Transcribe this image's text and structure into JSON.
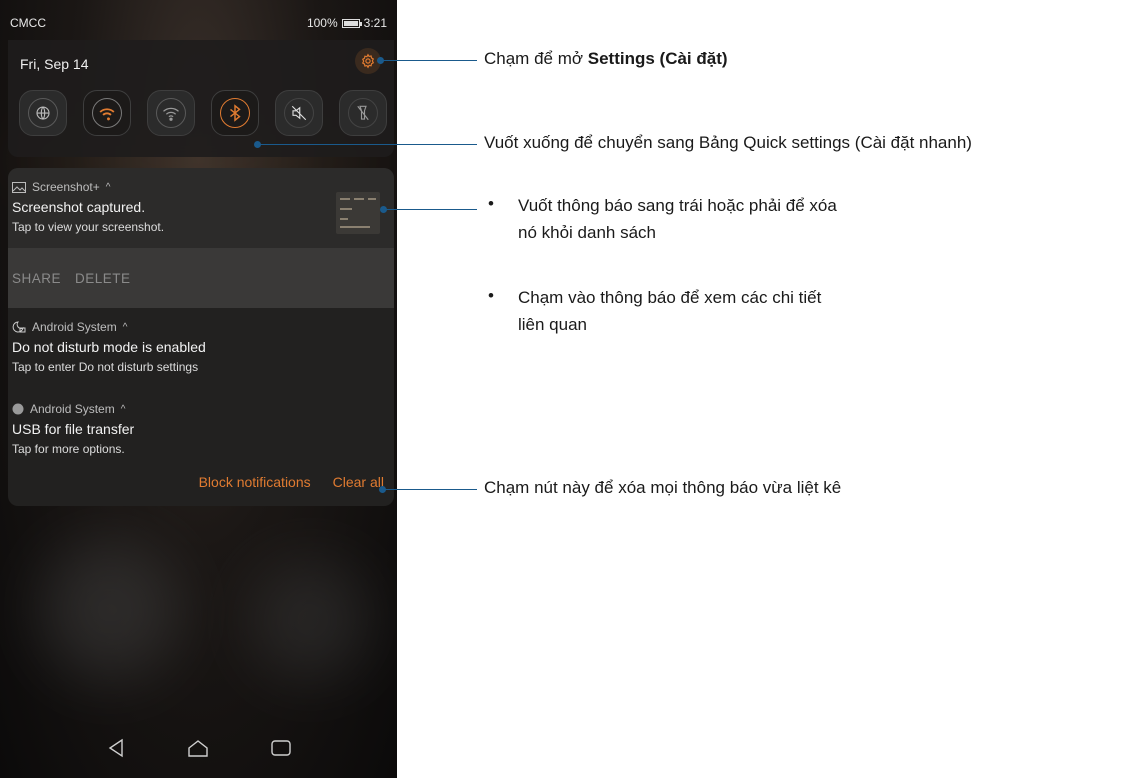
{
  "status_bar": {
    "carrier": "CMCC",
    "battery": "100%",
    "time": "3:21"
  },
  "quick_settings": {
    "date": "Fri, Sep 14",
    "tiles": [
      "globe-icon",
      "wifi-icon",
      "wifi-hotspot-icon",
      "bluetooth-icon",
      "mute-icon",
      "flashlight-off-icon"
    ]
  },
  "notifications": [
    {
      "app": "Screenshot+",
      "title": "Screenshot captured.",
      "text": "Tap to view your screenshot.",
      "actions": [
        "SHARE",
        "DELETE"
      ]
    },
    {
      "app": "Android System",
      "title": "Do not disturb mode is enabled",
      "text": "Tap to enter Do not disturb settings"
    },
    {
      "app": "Android System",
      "title": "USB for file transfer",
      "text": "Tap for more options."
    }
  ],
  "footer": {
    "block": "Block notifications",
    "clear": "Clear all"
  },
  "callouts": {
    "settings_prefix": "Chạm để mở ",
    "settings_bold": "Settings (Cài đặt)",
    "quick_settings": "Vuốt xuống để chuyển sang Bảng Quick settings (Cài đặt nhanh)",
    "swipe_line1": "Vuốt thông báo sang trái hoặc phải để xóa",
    "swipe_line2": "nó khỏi danh sách",
    "tap_line1": "Chạm vào thông báo để xem các chi tiết",
    "tap_line2": "liên quan",
    "clear_all": "Chạm nút này để xóa mọi thông báo vừa liệt kê"
  },
  "colors": {
    "accent": "#e07b31",
    "leader": "#1a5a8c"
  }
}
